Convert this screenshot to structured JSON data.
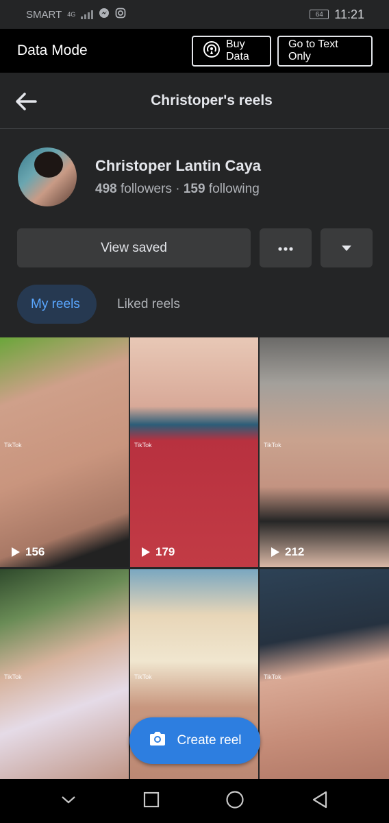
{
  "status_bar": {
    "carrier": "SMART",
    "network": "4G",
    "battery": "64",
    "time": "11:21"
  },
  "data_mode": {
    "title": "Data Mode",
    "buy_data": "Buy Data",
    "text_only": "Go to Text Only"
  },
  "header": {
    "title": "Christoper's reels"
  },
  "profile": {
    "name": "Christoper Lantin Caya",
    "followers_count": "498",
    "followers_label": "followers",
    "separator": "·",
    "following_count": "159",
    "following_label": "following"
  },
  "actions": {
    "view_saved": "View saved"
  },
  "tabs": [
    {
      "label": "My reels"
    },
    {
      "label": "Liked reels"
    }
  ],
  "reels": [
    {
      "views": "156",
      "watermark": "TikTok"
    },
    {
      "views": "179",
      "watermark": "TikTok"
    },
    {
      "views": "212",
      "watermark": "TikTok"
    },
    {
      "views": "",
      "watermark": "TikTok"
    },
    {
      "views": "",
      "watermark": "TikTok"
    },
    {
      "views": "",
      "watermark": "TikTok"
    }
  ],
  "fab": {
    "label": "Create reel"
  },
  "icons": {
    "back": "arrow-left-icon",
    "more": "more-dots-icon",
    "dropdown": "caret-down-icon",
    "camera": "camera-icon",
    "wifi": "signal-broadcast-icon"
  },
  "colors": {
    "accent": "#2d7ee0",
    "tab_active_text": "#5aa7ff",
    "tab_active_bg": "#263951"
  }
}
